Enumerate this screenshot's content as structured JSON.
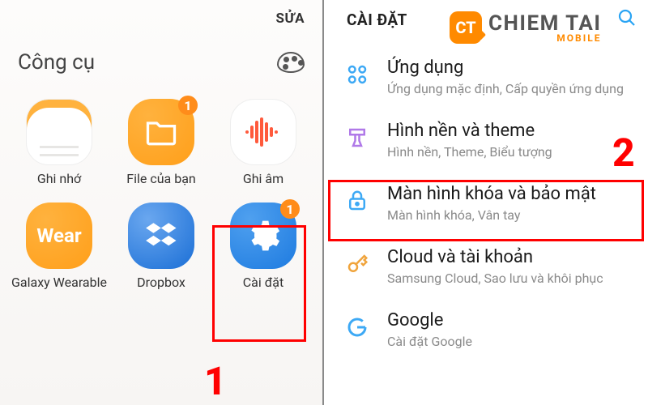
{
  "left": {
    "edit_label": "SỬA",
    "section_title": "Công cụ",
    "apps": [
      {
        "label": "Ghi nhớ",
        "badge": null
      },
      {
        "label": "File của bạn",
        "badge": "1"
      },
      {
        "label": "Ghi âm",
        "badge": null
      },
      {
        "label": "Galaxy Wearable",
        "badge": null
      },
      {
        "label": "Dropbox",
        "badge": null
      },
      {
        "label": "Cài đặt",
        "badge": "1"
      }
    ],
    "wear_text": "Wear"
  },
  "right": {
    "header": "CÀI ĐẶT",
    "rows": [
      {
        "title": "Ứng dụng",
        "sub": "Ứng dụng mặc định, Cấp quyền ứng dụng"
      },
      {
        "title": "Hình nền và theme",
        "sub": "Hình nền, Theme, Biểu tượng"
      },
      {
        "title": "Màn hình khóa và bảo mật",
        "sub": "Màn hình khóa, Vân tay"
      },
      {
        "title": "Cloud và tài khoản",
        "sub": "Samsung Cloud, Sao lưu và khôi phục"
      },
      {
        "title": "Google",
        "sub": "Cài đặt Google"
      }
    ]
  },
  "watermark": {
    "badge": "CT",
    "line1": "CHIEM TAI",
    "line2": "MOBILE"
  },
  "annotations": {
    "step1": "1",
    "step2": "2"
  }
}
